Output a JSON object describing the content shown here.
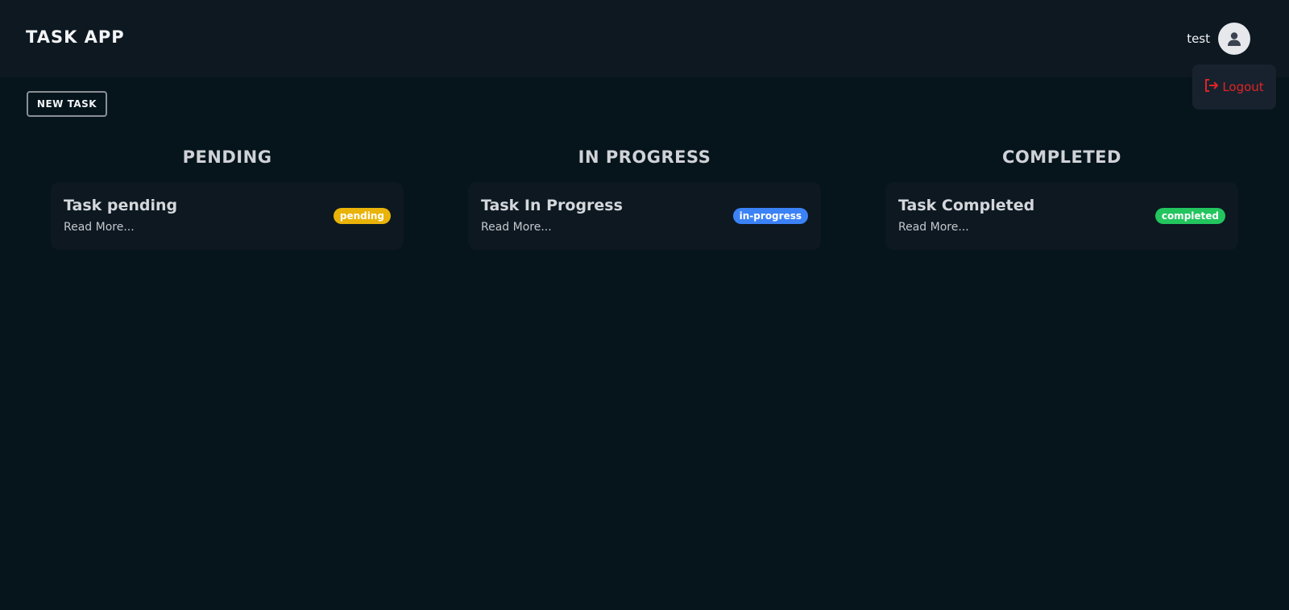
{
  "header": {
    "app_title": "TASK APP",
    "username": "test",
    "avatar_icon": "user-icon"
  },
  "user_menu": {
    "logout_label": "Logout",
    "logout_icon": "logout-icon",
    "logout_color": "#e02424"
  },
  "toolbar": {
    "new_task_label": "NEW TASK"
  },
  "columns": [
    {
      "heading": "PENDING",
      "tasks": [
        {
          "title": "Task pending",
          "read_more": "Read More...",
          "status": "pending",
          "status_color": "#eab308"
        }
      ]
    },
    {
      "heading": "IN PROGRESS",
      "tasks": [
        {
          "title": "Task In Progress",
          "read_more": "Read More...",
          "status": "in-progress",
          "status_color": "#3b82f6"
        }
      ]
    },
    {
      "heading": "COMPLETED",
      "tasks": [
        {
          "title": "Task Completed",
          "read_more": "Read More...",
          "status": "completed",
          "status_color": "#22c55e"
        }
      ]
    }
  ]
}
